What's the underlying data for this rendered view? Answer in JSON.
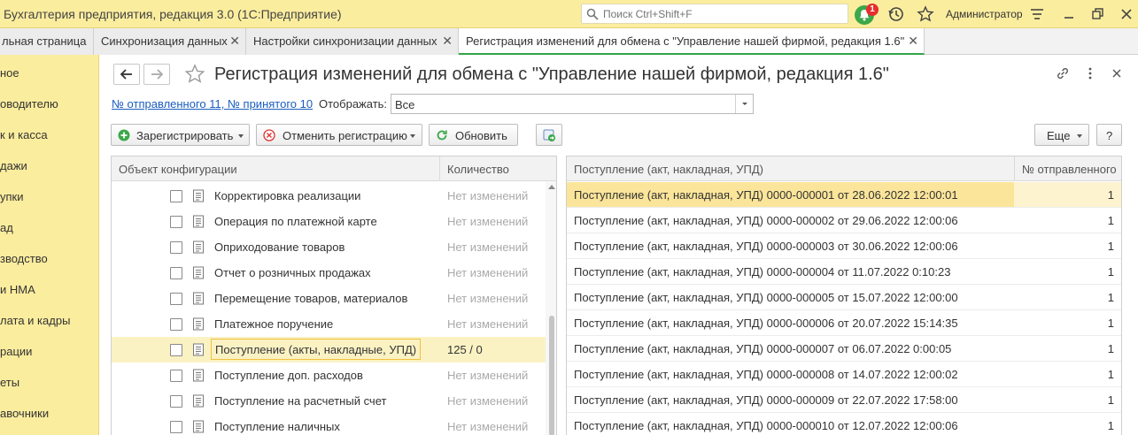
{
  "app": {
    "title": "Бухгалтерия предприятия, редакция 3.0  (1С:Предприятие)",
    "search_placeholder": "Поиск Ctrl+Shift+F",
    "notifications_count": "1",
    "user": "Администратор"
  },
  "tabs": [
    {
      "label": "льная страница"
    },
    {
      "label": "Синхронизация данных"
    },
    {
      "label": "Настройки синхронизации данных"
    },
    {
      "label": "Регистрация изменений для обмена с  \"Управление нашей фирмой, редакция 1.6\""
    }
  ],
  "sidebar": {
    "items": [
      "ное",
      "оводителю",
      "к и касса",
      "дажи",
      "упки",
      "ад",
      "зводство",
      "и НМА",
      "лата и кадры",
      "рации",
      "еты",
      "авочники"
    ]
  },
  "form": {
    "title": "Регистрация изменений для обмена с  \"Управление нашей фирмой, редакция 1.6\"",
    "sent_link": "№ отправленного 11, № принятого 10",
    "display_label": "Отображать:",
    "display_value": "Все"
  },
  "toolbar": {
    "register": "Зарегистрировать",
    "cancel_registration": "Отменить регистрацию",
    "refresh": "Обновить",
    "more": "Еще",
    "help": "?"
  },
  "left_table": {
    "col_object": "Объект конфигурации",
    "col_count": "Количество",
    "rows": [
      {
        "name": "Корректировка реализации",
        "count": "Нет изменений"
      },
      {
        "name": "Операция по платежной карте",
        "count": "Нет изменений"
      },
      {
        "name": "Оприходование товаров",
        "count": "Нет изменений"
      },
      {
        "name": "Отчет о розничных продажах",
        "count": "Нет изменений"
      },
      {
        "name": "Перемещение товаров, материалов",
        "count": "Нет изменений"
      },
      {
        "name": "Платежное поручение",
        "count": "Нет изменений"
      },
      {
        "name": "Поступление (акты, накладные, УПД)",
        "count": "125 / 0"
      },
      {
        "name": "Поступление доп. расходов",
        "count": "Нет изменений"
      },
      {
        "name": "Поступление на расчетный счет",
        "count": "Нет изменений"
      },
      {
        "name": "Поступление наличных",
        "count": "Нет изменений"
      }
    ]
  },
  "right_table": {
    "col_doc": "Поступление (акт, накладная, УПД)",
    "col_num": "№ отправленного",
    "rows": [
      {
        "doc": "Поступление (акт, накладная, УПД) 0000-000001 от 28.06.2022 12:00:01",
        "num": "1"
      },
      {
        "doc": "Поступление (акт, накладная, УПД) 0000-000002 от 29.06.2022 12:00:06",
        "num": "1"
      },
      {
        "doc": "Поступление (акт, накладная, УПД) 0000-000003 от 30.06.2022 12:00:06",
        "num": "1"
      },
      {
        "doc": "Поступление (акт, накладная, УПД) 0000-000004 от 11.07.2022 0:10:23",
        "num": "1"
      },
      {
        "doc": "Поступление (акт, накладная, УПД) 0000-000005 от 15.07.2022 12:00:00",
        "num": "1"
      },
      {
        "doc": "Поступление (акт, накладная, УПД) 0000-000006 от 20.07.2022 15:14:35",
        "num": "1"
      },
      {
        "doc": "Поступление (акт, накладная, УПД) 0000-000007 от 06.07.2022 0:00:05",
        "num": "1"
      },
      {
        "doc": "Поступление (акт, накладная, УПД) 0000-000008 от 14.07.2022 12:00:02",
        "num": "1"
      },
      {
        "doc": "Поступление (акт, накладная, УПД) 0000-000009 от 22.07.2022 17:58:00",
        "num": "1"
      },
      {
        "doc": "Поступление (акт, накладная, УПД) 0000-000010 от 12.07.2022 12:00:06",
        "num": "1"
      }
    ]
  },
  "colors": {
    "accent_yellow": "#fbed9e",
    "selection": "#fbe59a",
    "active_tab_line": "#35a447",
    "link": "#1a5dbf"
  },
  "icons": [
    "search-icon",
    "bell-icon",
    "history-icon",
    "star-icon",
    "menu-icon",
    "restore-window-icon",
    "back-arrow-icon",
    "forward-arrow-icon",
    "link-icon",
    "more-vertical-icon",
    "close-icon",
    "plus-icon",
    "cancel-icon",
    "refresh-icon",
    "export-icon",
    "document-icon"
  ]
}
